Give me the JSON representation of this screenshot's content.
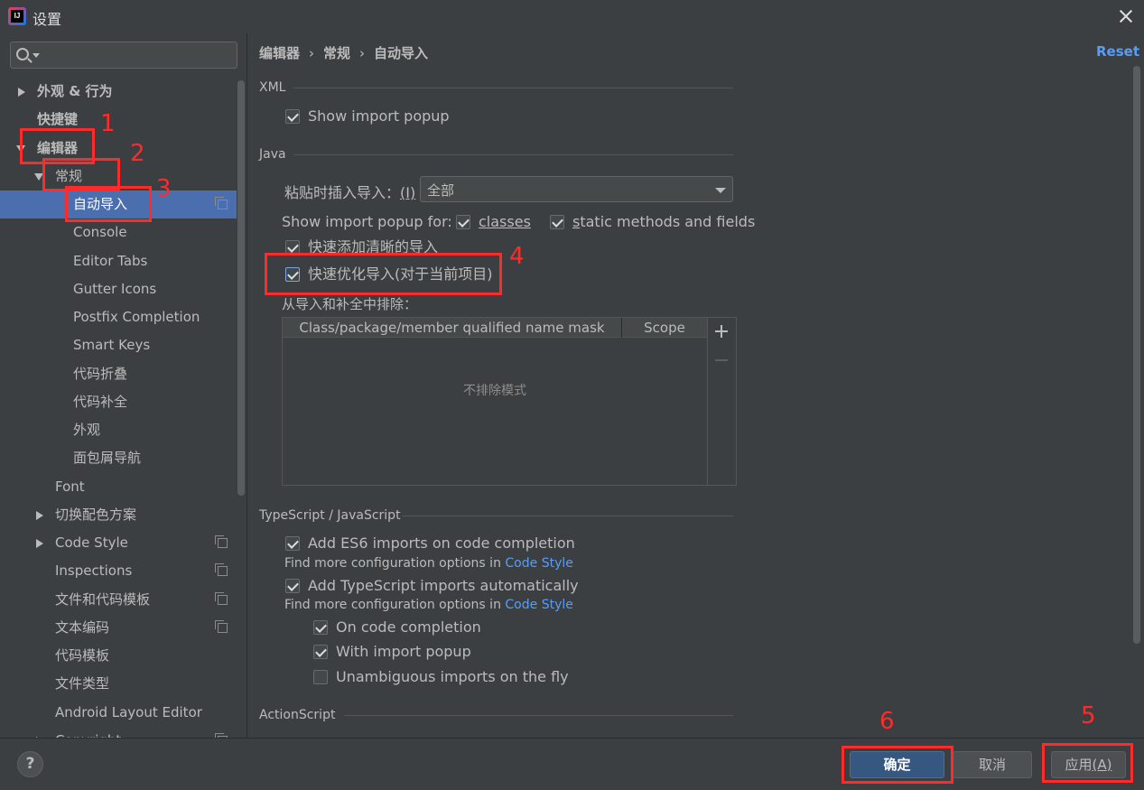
{
  "window": {
    "title": "设置"
  },
  "sidebar": {
    "search": {
      "placeholder": ""
    },
    "items": [
      {
        "label": "外观 & 行为"
      },
      {
        "label": "快捷键"
      },
      {
        "label": "编辑器"
      },
      {
        "label": "常规"
      },
      {
        "label": "自动导入"
      },
      {
        "label": "Console"
      },
      {
        "label": "Editor Tabs"
      },
      {
        "label": "Gutter Icons"
      },
      {
        "label": "Postfix Completion"
      },
      {
        "label": "Smart Keys"
      },
      {
        "label": "代码折叠"
      },
      {
        "label": "代码补全"
      },
      {
        "label": "外观"
      },
      {
        "label": "面包屑导航"
      },
      {
        "label": "Font"
      },
      {
        "label": "切换配色方案"
      },
      {
        "label": "Code Style"
      },
      {
        "label": "Inspections"
      },
      {
        "label": "文件和代码模板"
      },
      {
        "label": "文本编码"
      },
      {
        "label": "代码模板"
      },
      {
        "label": "文件类型"
      },
      {
        "label": "Android Layout Editor"
      },
      {
        "label": "Copyright"
      }
    ]
  },
  "breadcrumb": {
    "parts": [
      "编辑器",
      "常规",
      "自动导入"
    ],
    "sep": "›"
  },
  "reset_label": "Reset",
  "xml": {
    "title": "XML",
    "show_import_popup": "Show import popup"
  },
  "java": {
    "title": "Java",
    "paste_label": "粘贴时插入导入：",
    "paste_mnemonic": "(I)",
    "paste_value": "全部",
    "popup_for_label": "Show import popup for:",
    "classes_label": "classes",
    "static_label": "static methods and fields",
    "add_unambiguous": "快速添加清晰的导入",
    "optimize_imports": "快速优化导入(对于当前项目)",
    "exclude_label": "从导入和补全中排除：",
    "table": {
      "columns": [
        "Class/package/member qualified name mask",
        "Scope"
      ],
      "empty_text": "不排除模式"
    }
  },
  "typescript": {
    "title": "TypeScript / JavaScript",
    "add_es6": "Add ES6 imports on code completion",
    "hint1_prefix": "Find more configuration options in",
    "hint1_link": "Code Style",
    "add_ts": "Add TypeScript imports automatically",
    "hint2_prefix": "Find more configuration options in",
    "hint2_link": "Code Style",
    "on_completion": "On code completion",
    "with_popup": "With import popup",
    "unambiguous_fly": "Unambiguous imports on the fly"
  },
  "actionscript": {
    "title": "ActionScript"
  },
  "footer": {
    "help": "?",
    "ok": "确定",
    "cancel": "取消",
    "apply": "应用",
    "apply_mnemonic": "(A)"
  },
  "annotations": [
    "1",
    "2",
    "3",
    "4",
    "5",
    "6"
  ],
  "colors": {
    "background": "#3c3f41",
    "selection": "#4b6eaf",
    "link": "#589df6",
    "primary_button": "#365880",
    "annotation": "#ff2b2b"
  }
}
